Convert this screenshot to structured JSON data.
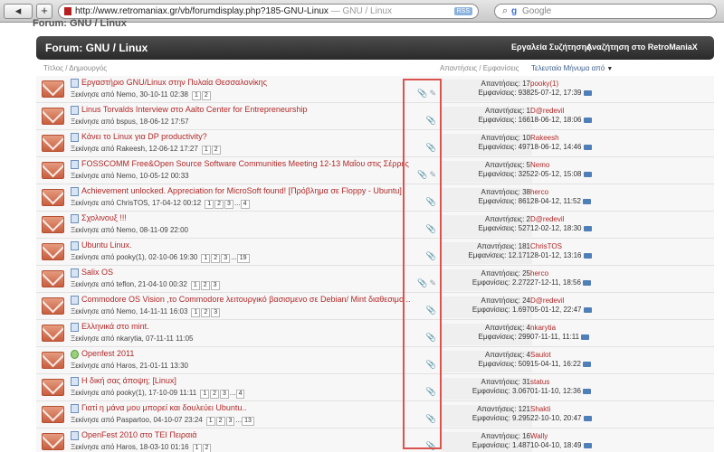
{
  "browser": {
    "back_label": "◂",
    "add_label": "+",
    "url": "http://www.retromaniax.gr/vb/forumdisplay.php?185-GNU-Linux",
    "url_sep": " — ",
    "page_title_tail": "GNU / Linux",
    "rss_label": "RSS",
    "search_placeholder": "Google"
  },
  "page": {
    "breadcrumb_cut": "Forum: GNU / Linux",
    "forum_title": "Forum: GNU / Linux",
    "tools_label": "Εργαλεία Συζήτησης",
    "search_label": "Αναζήτηση στο RetroManiaX",
    "col_title": "Τίτλος / Δημιουργός",
    "col_stats": "Απαντήσεις / Εμφανίσεις",
    "col_last": "Τελευταίο Μήνυμα από"
  },
  "threads": [
    {
      "title": "Εργαστήριο GNU/Linux στην Πυλαία Θεσσαλονίκης",
      "starter": "Ξεκίνησε από Nemo, 30-10-11 02:38",
      "pages": [
        "1",
        "2"
      ],
      "icons": [
        "📎",
        "✎"
      ],
      "replies": "Απαντήσεις: 17",
      "views": "Εμφανίσεις: 938",
      "last_user": "pooky(1)",
      "last_date": "25-07-12, 17:39",
      "hot": false
    },
    {
      "title": "Linus Torvalds Interview στο Aalto Center for Entrepreneurship",
      "starter": "Ξεκίνησε από bspus, 18-06-12 17:57",
      "pages": [],
      "icons": [
        "📎"
      ],
      "replies": "Απαντήσεις: 1",
      "views": "Εμφανίσεις: 166",
      "last_user": "D@redevil",
      "last_date": "18-06-12, 18:06",
      "hot": false
    },
    {
      "title": "Κάνει το Linux για DP productivity?",
      "starter": "Ξεκίνησε από Rakeesh, 12-06-12 17:27",
      "pages": [
        "1",
        "2"
      ],
      "icons": [
        "📎"
      ],
      "replies": "Απαντήσεις: 10",
      "views": "Εμφανίσεις: 497",
      "last_user": "Rakeesh",
      "last_date": "18-06-12, 14:46",
      "hot": false
    },
    {
      "title": "FOSSCOMM Free&Open Source Software Communities Meeting 12-13 Μαΐου στις Σέρρες",
      "starter": "Ξεκίνησε από Nemo, 10-05-12 00:33",
      "pages": [],
      "icons": [
        "📎",
        "✎"
      ],
      "replies": "Απαντήσεις: 5",
      "views": "Εμφανίσεις: 325",
      "last_user": "Nemo",
      "last_date": "22-05-12, 15:08",
      "hot": false
    },
    {
      "title": "Achievement unlocked. Appreciation for MicroSoft found! [Πρόβλημα σε Floppy - Ubuntu]",
      "starter": "Ξεκίνησε από ChrisTOS, 17-04-12 00:12",
      "pages": [
        "1",
        "2",
        "3",
        "...",
        "4"
      ],
      "icons": [
        "📎"
      ],
      "replies": "Απαντήσεις: 38",
      "views": "Εμφανίσεις: 861",
      "last_user": "herco",
      "last_date": "28-04-12, 11:52",
      "hot": false
    },
    {
      "title": "Σχολινουξ !!!",
      "starter": "Ξεκίνησε από Nemo, 08-11-09 22:00",
      "pages": [],
      "icons": [
        "📎"
      ],
      "replies": "Απαντήσεις: 2",
      "views": "Εμφανίσεις: 527",
      "last_user": "D@redevil",
      "last_date": "12-02-12, 18:30",
      "hot": false
    },
    {
      "title": "Ubuntu Linux.",
      "starter": "Ξεκίνησε από pooky(1), 02-10-06 19:30",
      "pages": [
        "1",
        "2",
        "3",
        "...",
        "19"
      ],
      "icons": [
        "📎"
      ],
      "replies": "Απαντήσεις: 181",
      "views": "Εμφανίσεις: 12.171",
      "last_user": "ChrisTOS",
      "last_date": "28-01-12, 13:16",
      "hot": false
    },
    {
      "title": "Salix OS",
      "starter": "Ξεκίνησε από teflon, 21-04-10 00:32",
      "pages": [
        "1",
        "2",
        "3"
      ],
      "icons": [
        "📎",
        "✎"
      ],
      "replies": "Απαντήσεις: 25",
      "views": "Εμφανίσεις: 2.272",
      "last_user": "herco",
      "last_date": "27-12-11, 18:56",
      "hot": false
    },
    {
      "title": "Commodore OS Vision ,το Commodore λειτουργικό βασισμενο σε Debian/ Mint διαθεσιμο ..",
      "starter": "Ξεκίνησε από Nemo, 14-11-11 16:03",
      "pages": [
        "1",
        "2",
        "3"
      ],
      "icons": [
        "📎"
      ],
      "replies": "Απαντήσεις: 24",
      "views": "Εμφανίσεις: 1.697",
      "last_user": "D@redevil",
      "last_date": "05-01-12, 22:47",
      "hot": false
    },
    {
      "title": "Ελληνικά στο mint.",
      "starter": "Ξεκίνησε από nkarytia, 07-11-11 11:05",
      "pages": [],
      "icons": [
        "📎"
      ],
      "replies": "Απαντήσεις: 4",
      "views": "Εμφανίσεις: 299",
      "last_user": "nkarytia",
      "last_date": "07-11-11, 11:11",
      "hot": false
    },
    {
      "title": "Openfest 2011",
      "starter": "Ξεκίνησε από Haros, 21-01-11 13:30",
      "pages": [],
      "icons": [
        "📎"
      ],
      "replies": "Απαντήσεις: 4",
      "views": "Εμφανίσεις: 509",
      "last_user": "Saulot",
      "last_date": "15-04-11, 16:22",
      "hot": true
    },
    {
      "title": "Η δική σας άποψη; [Linux]",
      "starter": "Ξεκίνησε από pooky(1), 17-10-09 11:11",
      "pages": [
        "1",
        "2",
        "3",
        "...",
        "4"
      ],
      "icons": [
        "📎"
      ],
      "replies": "Απαντήσεις: 31",
      "views": "Εμφανίσεις: 3.067",
      "last_user": "status",
      "last_date": "01-11-10, 12:36",
      "hot": false
    },
    {
      "title": "Γιατί η μάνα μου μπορεί και δουλεύει Ubuntu..",
      "starter": "Ξεκίνησε από Paspartoo, 04-10-07 23:24",
      "pages": [
        "1",
        "2",
        "3",
        "...",
        "13"
      ],
      "icons": [
        "📎"
      ],
      "replies": "Απαντήσεις: 121",
      "views": "Εμφανίσεις: 9.295",
      "last_user": "Shakti",
      "last_date": "22-10-10, 20:47",
      "hot": false
    },
    {
      "title": "OpenFest 2010 στο ΤΕΙ Πειραιά",
      "starter": "Ξεκίνησε από Haros, 18-03-10 01:16",
      "pages": [
        "1",
        "2"
      ],
      "icons": [
        "📎"
      ],
      "replies": "Απαντήσεις: 16",
      "views": "Εμφανίσεις: 1.487",
      "last_user": "Wally",
      "last_date": "10-04-10, 18:49",
      "hot": false
    }
  ]
}
